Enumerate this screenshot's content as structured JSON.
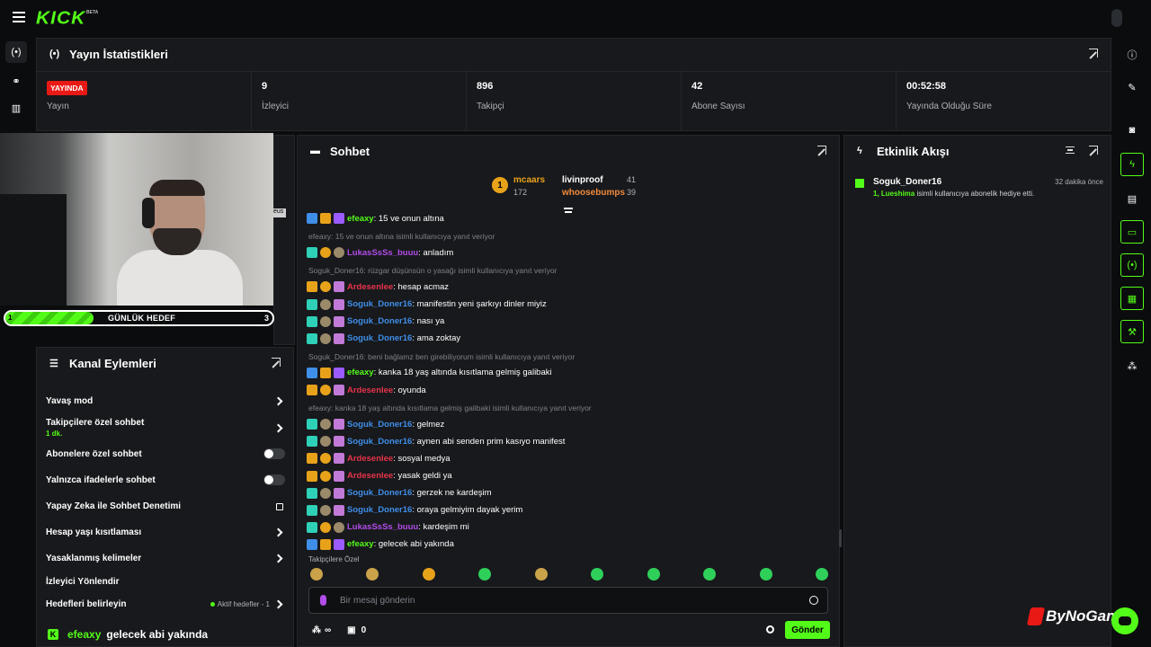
{
  "brand": {
    "logo": "KICK",
    "beta": "BETA"
  },
  "stats": {
    "title": "Yayın İstatistikleri",
    "items": [
      {
        "value": "YAYINDA",
        "label": "Yayın"
      },
      {
        "value": "9",
        "label": "İzleyici"
      },
      {
        "value": "896",
        "label": "Takipçi"
      },
      {
        "value": "42",
        "label": "Abone Sayısı"
      },
      {
        "value": "00:52:58",
        "label": "Yayında Olduğu Süre"
      }
    ]
  },
  "goal": {
    "current": "1",
    "title": "GÜNLÜK HEDEF",
    "target": "3",
    "progress": 0.33
  },
  "behind_tag": "eus",
  "channel_actions": {
    "title": "Kanal Eylemleri",
    "items": [
      {
        "label": "Yavaş mod",
        "control": "chevron"
      },
      {
        "label": "Takipçilere özel sohbet",
        "sub": "1 dk.",
        "control": "chevron"
      },
      {
        "label": "Abonelere özel sohbet",
        "control": "toggle"
      },
      {
        "label": "Yalnızca ifadelerle sohbet",
        "control": "toggle"
      },
      {
        "label": "Yapay Zeka ile Sohbet Denetimi",
        "control": "link"
      },
      {
        "label": "Hesap yaşı kısıtlaması",
        "control": "chevron"
      },
      {
        "label": "Yasaklanmış kelimeler",
        "control": "chevron"
      },
      {
        "label": "İzleyici Yönlendir",
        "control": "none"
      },
      {
        "label": "Hedefleri belirleyin",
        "control": "chevron",
        "extra": "Aktif hedefler - 1"
      }
    ],
    "footer_user": "efeaxy",
    "footer_text": "gelecek abi yakında"
  },
  "chat": {
    "title": "Sohbet",
    "leaders": {
      "first": {
        "name": "mcaars",
        "count": "172"
      },
      "second": {
        "name": "livinproof",
        "count": "41"
      },
      "third": {
        "name": "whoosebumps",
        "count": "39"
      }
    },
    "messages": [
      {
        "type": "msg",
        "badges": [
          "b-blue",
          "b-gold",
          "b-purple"
        ],
        "user": "efeaxy",
        "color": "#53fc18",
        "text": ": 15 ve onun altına"
      },
      {
        "type": "reply",
        "text": "efeaxy: 15 ve onun altına isimli kullanıcıya yanıt veriyor"
      },
      {
        "type": "msg",
        "badges": [
          "b-teal",
          "b-round-gold",
          "b-round-grey"
        ],
        "user": "LukasSsSs_buuu",
        "color": "#b04ce8",
        "text": ": anladım"
      },
      {
        "type": "reply",
        "text": "Soguk_Doner16: rüzgar düşünsün o yasağı isimli kullanıcıya yanıt veriyor"
      },
      {
        "type": "msg",
        "badges": [
          "b-gold",
          "b-round-gold",
          "b-pink"
        ],
        "user": "Ardesenlee",
        "color": "#e8344a",
        "text": ": hesap acmaz"
      },
      {
        "type": "msg",
        "badges": [
          "b-teal",
          "b-round-grey",
          "b-pink"
        ],
        "user": "Soguk_Doner16",
        "color": "#3f8ee8",
        "text": ": manifestin yeni şarkıyı dinler miyiz"
      },
      {
        "type": "msg",
        "badges": [
          "b-teal",
          "b-round-grey",
          "b-pink"
        ],
        "user": "Soguk_Doner16",
        "color": "#3f8ee8",
        "text": ": nası ya"
      },
      {
        "type": "msg",
        "badges": [
          "b-teal",
          "b-round-grey",
          "b-pink"
        ],
        "user": "Soguk_Doner16",
        "color": "#3f8ee8",
        "text": ": ama zoktay"
      },
      {
        "type": "reply",
        "text": "Soguk_Doner16: beni bağlamz ben girebiliyorum isimli kullanıcıya yanıt veriyor"
      },
      {
        "type": "msg",
        "badges": [
          "b-blue",
          "b-gold",
          "b-purple"
        ],
        "user": "efeaxy",
        "color": "#53fc18",
        "text": ": kanka 18 yaş altında kısıtlama gelmiş galibaki"
      },
      {
        "type": "msg",
        "badges": [
          "b-gold",
          "b-round-gold",
          "b-pink"
        ],
        "user": "Ardesenlee",
        "color": "#e8344a",
        "text": ": oyunda"
      },
      {
        "type": "reply",
        "text": "efeaxy: kanka 18 yaş altında kısıtlama gelmiş galibaki isimli kullanıcıya yanıt veriyor"
      },
      {
        "type": "msg",
        "badges": [
          "b-teal",
          "b-round-grey",
          "b-pink"
        ],
        "user": "Soguk_Doner16",
        "color": "#3f8ee8",
        "text": ": gelmez"
      },
      {
        "type": "msg",
        "badges": [
          "b-teal",
          "b-round-grey",
          "b-pink"
        ],
        "user": "Soguk_Doner16",
        "color": "#3f8ee8",
        "text": ": aynen abi senden prim kasıyo manifest"
      },
      {
        "type": "msg",
        "badges": [
          "b-gold",
          "b-round-gold",
          "b-pink"
        ],
        "user": "Ardesenlee",
        "color": "#e8344a",
        "text": ": sosyal medya"
      },
      {
        "type": "msg",
        "badges": [
          "b-gold",
          "b-round-gold",
          "b-pink"
        ],
        "user": "Ardesenlee",
        "color": "#e8344a",
        "text": ": yasak geldi ya"
      },
      {
        "type": "msg",
        "badges": [
          "b-teal",
          "b-round-grey",
          "b-pink"
        ],
        "user": "Soguk_Doner16",
        "color": "#3f8ee8",
        "text": ": gerzek ne kardeşim"
      },
      {
        "type": "msg",
        "badges": [
          "b-teal",
          "b-round-grey",
          "b-pink"
        ],
        "user": "Soguk_Doner16",
        "color": "#3f8ee8",
        "text": ": oraya gelmiyim dayak yerim"
      },
      {
        "type": "msg",
        "badges": [
          "b-teal",
          "b-round-gold",
          "b-round-grey"
        ],
        "user": "LukasSsSs_buuu",
        "color": "#b04ce8",
        "text": ": kardeşim mi"
      },
      {
        "type": "msg",
        "badges": [
          "b-blue",
          "b-gold",
          "b-purple"
        ],
        "user": "efeaxy",
        "color": "#53fc18",
        "text": ": gelecek abi yakında"
      }
    ],
    "follow_only": "Takipçilere Özel",
    "emote_count": 10,
    "input_placeholder": "Bir mesaj gönderin",
    "infinity": "∞",
    "count": "0",
    "send": "Gönder"
  },
  "activity": {
    "title": "Etkinlik Akışı",
    "items": [
      {
        "user": "Soguk_Doner16",
        "time": "32 dakika önce",
        "highlight": "1, Lueshima",
        "desc": " isimli kullanıcıya abonelik hediye etti."
      }
    ]
  },
  "watermark": {
    "text": "ByNoGame"
  }
}
